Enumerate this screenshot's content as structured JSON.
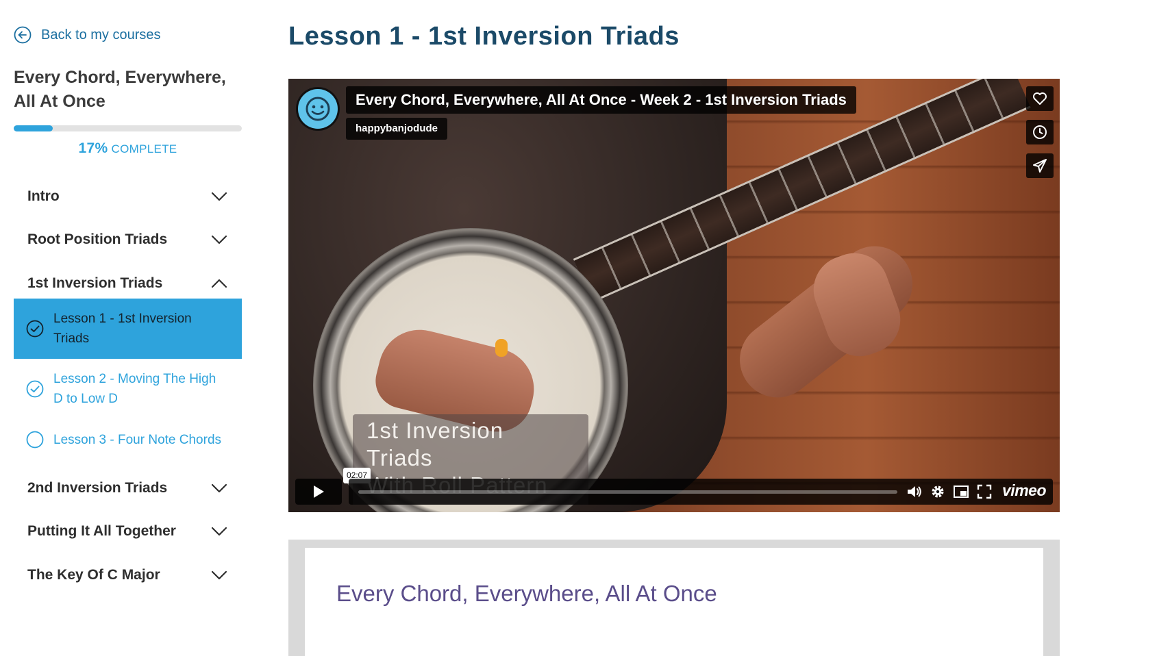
{
  "sidebar": {
    "back_label": "Back to my courses",
    "course_title": "Every Chord, Everywhere, All At Once",
    "progress": {
      "percent": 0.17,
      "percent_label": "17%",
      "complete_label": "COMPLETE"
    },
    "sections": [
      {
        "label": "Intro",
        "expanded": false
      },
      {
        "label": "Root Position Triads",
        "expanded": false
      },
      {
        "label": "1st Inversion Triads",
        "expanded": true
      },
      {
        "label": "2nd Inversion Triads",
        "expanded": false
      },
      {
        "label": "Putting It All Together",
        "expanded": false
      },
      {
        "label": "The Key Of C Major",
        "expanded": false
      }
    ],
    "lessons": [
      {
        "label": "Lesson 1 - 1st Inversion Triads",
        "status": "current-complete"
      },
      {
        "label": "Lesson 2 - Moving The High D to Low D",
        "status": "complete"
      },
      {
        "label": "Lesson 3 - Four Note Chords",
        "status": "incomplete"
      }
    ]
  },
  "main": {
    "lesson_title": "Lesson 1 - 1st Inversion Triads",
    "video": {
      "title": "Every Chord, Everywhere, All At Once - Week 2 - 1st Inversion Triads",
      "channel": "happybanjodude",
      "overlay_line1": "1st Inversion Triads",
      "overlay_line2": "With Roll Pattern",
      "hover_time": "02:07",
      "brand": "vimeo"
    },
    "description_title": "Every Chord, Everywhere, All At Once"
  },
  "colors": {
    "accent": "#2ea3dc",
    "heading": "#1b4a68",
    "description_title": "#5a4d8a"
  }
}
